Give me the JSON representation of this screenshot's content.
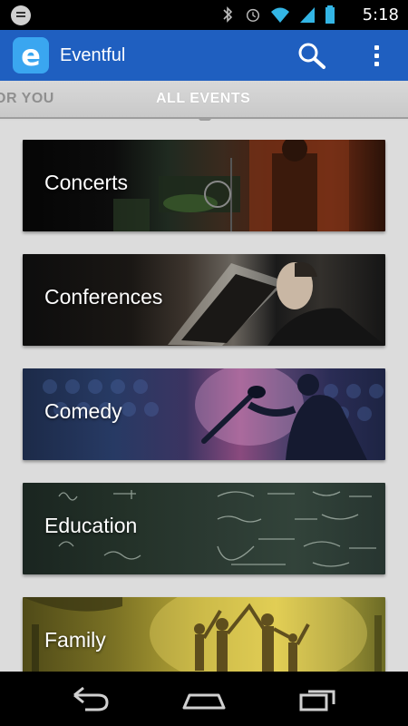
{
  "status_bar": {
    "time": "5:18"
  },
  "app_bar": {
    "logo_letter": "e",
    "title": "Eventful",
    "search_icon": "search-icon",
    "overflow_icon": "overflow-menu-icon"
  },
  "tabs": [
    {
      "label": "OR YOU",
      "selected": false
    },
    {
      "label": "ALL EVENTS",
      "selected": true
    }
  ],
  "categories": [
    {
      "label": "Concerts"
    },
    {
      "label": "Conferences"
    },
    {
      "label": "Comedy"
    },
    {
      "label": "Education"
    },
    {
      "label": "Family"
    }
  ],
  "colors": {
    "app_bar": "#1f5fc0",
    "logo_bg": "#3aa6f0",
    "background": "#dcdcdc"
  }
}
